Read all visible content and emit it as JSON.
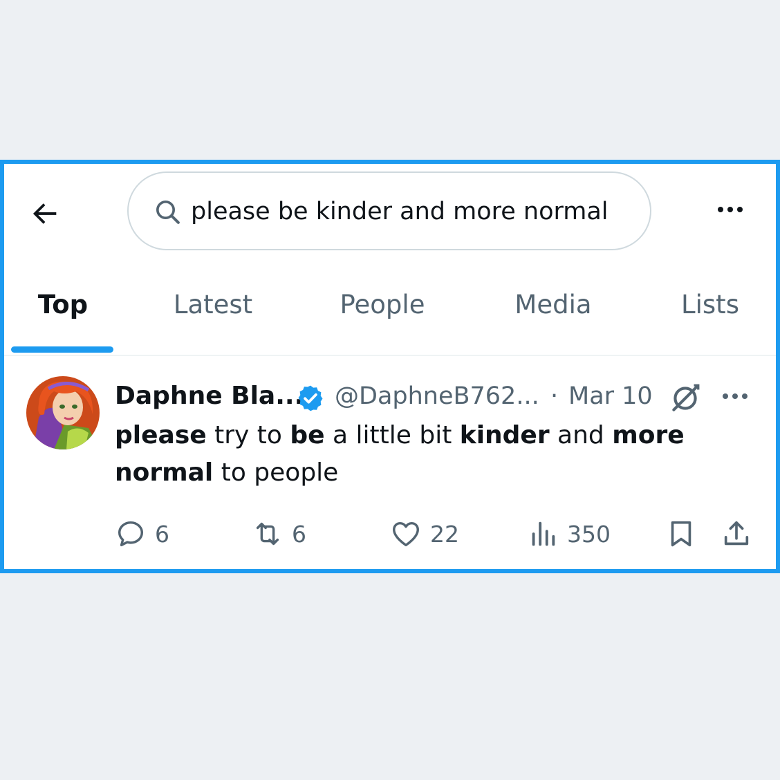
{
  "search": {
    "query": "please be kinder and more normal"
  },
  "tabs": [
    {
      "label": "Top",
      "active": true
    },
    {
      "label": "Latest",
      "active": false
    },
    {
      "label": "People",
      "active": false
    },
    {
      "label": "Media",
      "active": false
    },
    {
      "label": "Lists",
      "active": false
    }
  ],
  "tweet": {
    "display_name": "Daphne Bla...",
    "handle": "@DaphneB762...",
    "separator": "·",
    "date": "Mar 10",
    "text_segments": [
      {
        "text": "please",
        "bold": true
      },
      {
        "text": " try to ",
        "bold": false
      },
      {
        "text": "be",
        "bold": true
      },
      {
        "text": " a little bit ",
        "bold": false
      },
      {
        "text": "kinder",
        "bold": true
      },
      {
        "text": " and ",
        "bold": false
      },
      {
        "text": "more",
        "bold": true
      },
      {
        "text": " ",
        "bold": false
      },
      {
        "text": "normal",
        "bold": true
      },
      {
        "text": " to people",
        "bold": false
      }
    ],
    "metrics": {
      "replies": "6",
      "reposts": "6",
      "likes": "22",
      "views": "350"
    }
  },
  "colors": {
    "accent": "#1d9bf0",
    "text_primary": "#0f1419",
    "text_secondary": "#536471",
    "page_background": "#edf0f3"
  },
  "icons": {
    "back": "arrow-left-icon",
    "search": "search-icon",
    "more": "more-dots-icon",
    "verified": "verified-badge-icon",
    "grok": "grok-icon",
    "reply": "reply-icon",
    "repost": "repost-icon",
    "like": "heart-icon",
    "views": "analytics-icon",
    "bookmark": "bookmark-icon",
    "share": "share-icon"
  }
}
